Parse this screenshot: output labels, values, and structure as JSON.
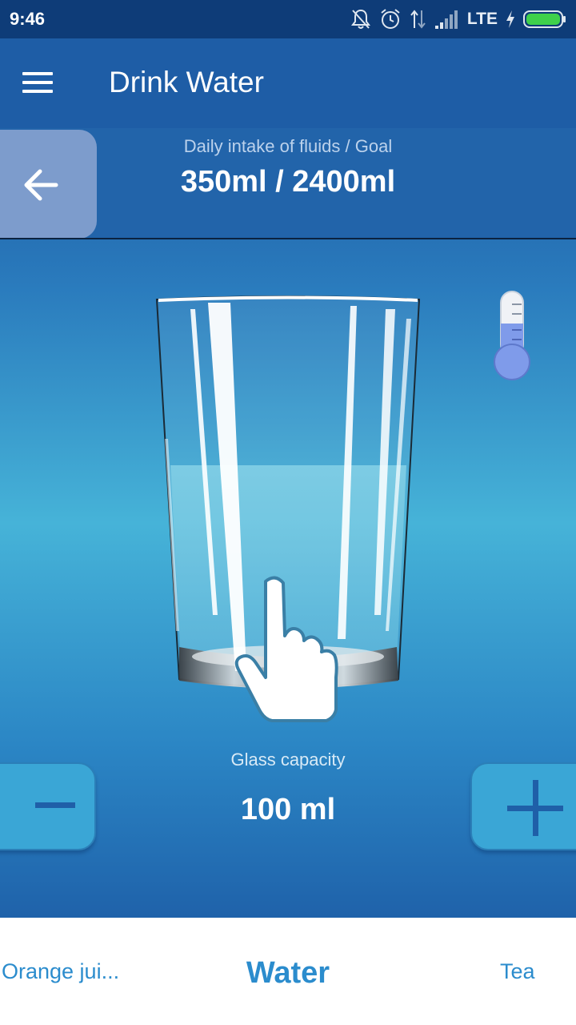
{
  "status_bar": {
    "time": "9:46",
    "network": "LTE",
    "icons": [
      "notifications-off-icon",
      "alarm-icon",
      "data-arrows-icon",
      "signal-icon",
      "charging-icon",
      "battery-icon"
    ]
  },
  "app_bar": {
    "title": "Drink Water",
    "menu_icon": "hamburger-menu-icon"
  },
  "intake": {
    "label": "Daily intake of fluids / Goal",
    "value": "350ml / 2400ml",
    "back_icon": "arrow-left-icon"
  },
  "glass": {
    "fill_fraction": 0.55,
    "thermometer_icon": "thermometer-icon",
    "hand_icon": "tap-hand-icon"
  },
  "capacity": {
    "label": "Glass capacity",
    "value": "100 ml",
    "minus_icon": "minus-icon",
    "plus_icon": "plus-icon"
  },
  "tabs": {
    "left": "Orange jui...",
    "center": "Water",
    "right": "Tea"
  },
  "colors": {
    "status_bar": "#0e3c78",
    "app_bar": "#1e5da6",
    "accent_tab": "#2b8ccd",
    "button": "#3aa6d6"
  }
}
